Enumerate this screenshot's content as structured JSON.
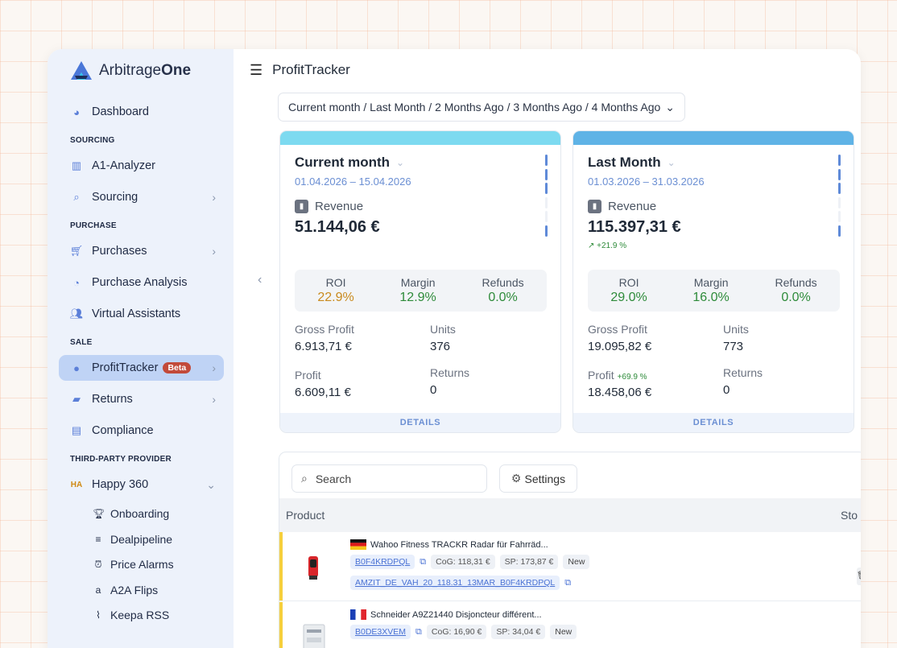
{
  "brand": {
    "name_prefix": "Arbitrage",
    "name_bold": "One"
  },
  "sidebar": {
    "dashboard": "Dashboard",
    "sections": [
      "SOURCING",
      "PURCHASE",
      "SALE",
      "THIRD-PARTY PROVIDER"
    ],
    "a1_analyzer": "A1-Analyzer",
    "sourcing": "Sourcing",
    "purchases": "Purchases",
    "purchase_analysis": "Purchase Analysis",
    "virtual_assistants": "Virtual Assistants",
    "profittracker": "ProfitTracker",
    "beta": "Beta",
    "returns": "Returns",
    "compliance": "Compliance",
    "happy360": "Happy 360",
    "ha_mark": "HA",
    "sub": {
      "onboarding": "Onboarding",
      "dealpipeline": "Dealpipeline",
      "price_alarms": "Price Alarms",
      "a2a_flips": "A2A Flips",
      "keepa_rss": "Keepa RSS"
    }
  },
  "header": {
    "title": "ProfitTracker"
  },
  "period": {
    "label": "Current month / Last Month / 2 Months Ago / 3 Months Ago / 4 Months Ago"
  },
  "cards": [
    {
      "title": "Current month",
      "dates": "01.04.2026 – 15.04.2026",
      "strip_color": "#7ddaf0",
      "revenue_label": "Revenue",
      "revenue": "51.144,06 €",
      "trend": "",
      "roi_label": "ROI",
      "roi": "22.9%",
      "roi_color": "#c98a1e",
      "margin_label": "Margin",
      "margin": "12.9%",
      "refunds_label": "Refunds",
      "refunds": "0.0%",
      "gross_label": "Gross Profit",
      "gross": "6.913,71 €",
      "units_label": "Units",
      "units": "376",
      "profit_label": "Profit",
      "profit_trend": "",
      "profit": "6.609,11 €",
      "returns_label": "Returns",
      "returns": "0",
      "details": "DETAILS"
    },
    {
      "title": "Last Month",
      "dates": "01.03.2026 – 31.03.2026",
      "strip_color": "#5fb3e6",
      "revenue_label": "Revenue",
      "revenue": "115.397,31 €",
      "trend": "↗ +21.9 %",
      "roi_label": "ROI",
      "roi": "29.0%",
      "roi_color": "#2e8b3a",
      "margin_label": "Margin",
      "margin": "16.0%",
      "refunds_label": "Refunds",
      "refunds": "0.0%",
      "gross_label": "Gross Profit",
      "gross": "19.095,82 €",
      "units_label": "Units",
      "units": "773",
      "profit_label": "Profit",
      "profit_trend": "+69.9 %",
      "profit": "18.458,06 €",
      "returns_label": "Returns",
      "returns": "0",
      "details": "DETAILS"
    }
  ],
  "table": {
    "search_placeholder": "Search",
    "settings": "Settings",
    "col_product": "Product",
    "col_stock": "Sto",
    "rows": [
      {
        "title": "Wahoo Fitness TRACKR Radar für Fahrräd...",
        "asin": "B0F4KRDPQL",
        "cog": "CoG: 118,31 €",
        "sp": "SP: 173,87 €",
        "status": "New",
        "sku": "AMZIT_DE_VAH_20_118.31_13MAR_B0F4KRDPQL"
      },
      {
        "title": "Schneider A9Z21440 Disjoncteur différent...",
        "asin": "B0DE3XVEM",
        "cog": "CoG: 16,90 €",
        "sp": "SP: 34,04 €",
        "status": "New"
      }
    ]
  },
  "colors": {
    "accent": "#5b7fd8",
    "sale_active": "#bfd3f5",
    "positive": "#2e8b3a",
    "warn_row": "#f6cf3c"
  }
}
